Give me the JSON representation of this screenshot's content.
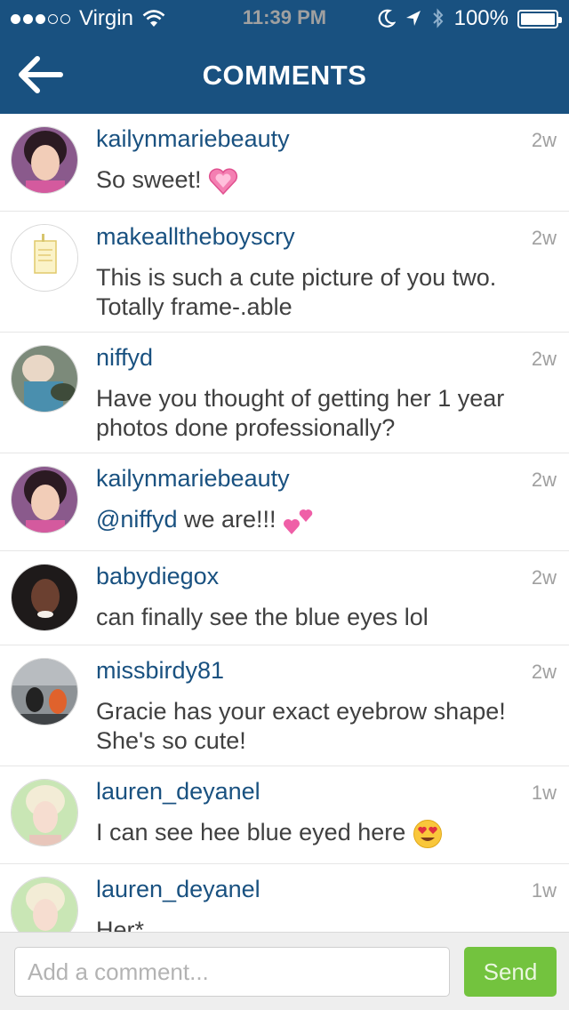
{
  "status_bar": {
    "carrier": "Virgin",
    "time": "11:39 PM",
    "battery": "100%",
    "signal_bars_filled": 3,
    "signal_bars_total": 5
  },
  "nav": {
    "title": "COMMENTS",
    "back_icon": "back-arrow-icon"
  },
  "colors": {
    "header": "#195180",
    "username": "#195180",
    "send": "#73c33e"
  },
  "comments": [
    {
      "username": "kailynmariebeauty",
      "time": "2w",
      "text": "So sweet!",
      "emoji": "heart"
    },
    {
      "username": "makealltheboyscry",
      "time": "2w",
      "text": "This is such a cute picture of you two. Totally frame-.able"
    },
    {
      "username": "niffyd",
      "time": "2w",
      "text": "Have you thought of getting her 1 year photos done professionally?"
    },
    {
      "username": "kailynmariebeauty",
      "time": "2w",
      "mention": "@niffyd",
      "text": " we are!!!",
      "emoji": "two-hearts"
    },
    {
      "username": "babydiegox",
      "time": "2w",
      "text": "can finally see the blue eyes lol"
    },
    {
      "username": "missbirdy81",
      "time": "2w",
      "text": "Gracie has your exact eyebrow shape! She's so cute!"
    },
    {
      "username": "lauren_deyanel",
      "time": "1w",
      "text": "I can see hee blue eyed here",
      "emoji": "heart-eyes"
    },
    {
      "username": "lauren_deyanel",
      "time": "1w",
      "text": "Her*"
    }
  ],
  "composer": {
    "placeholder": "Add a comment...",
    "value": "",
    "send_label": "Send"
  }
}
